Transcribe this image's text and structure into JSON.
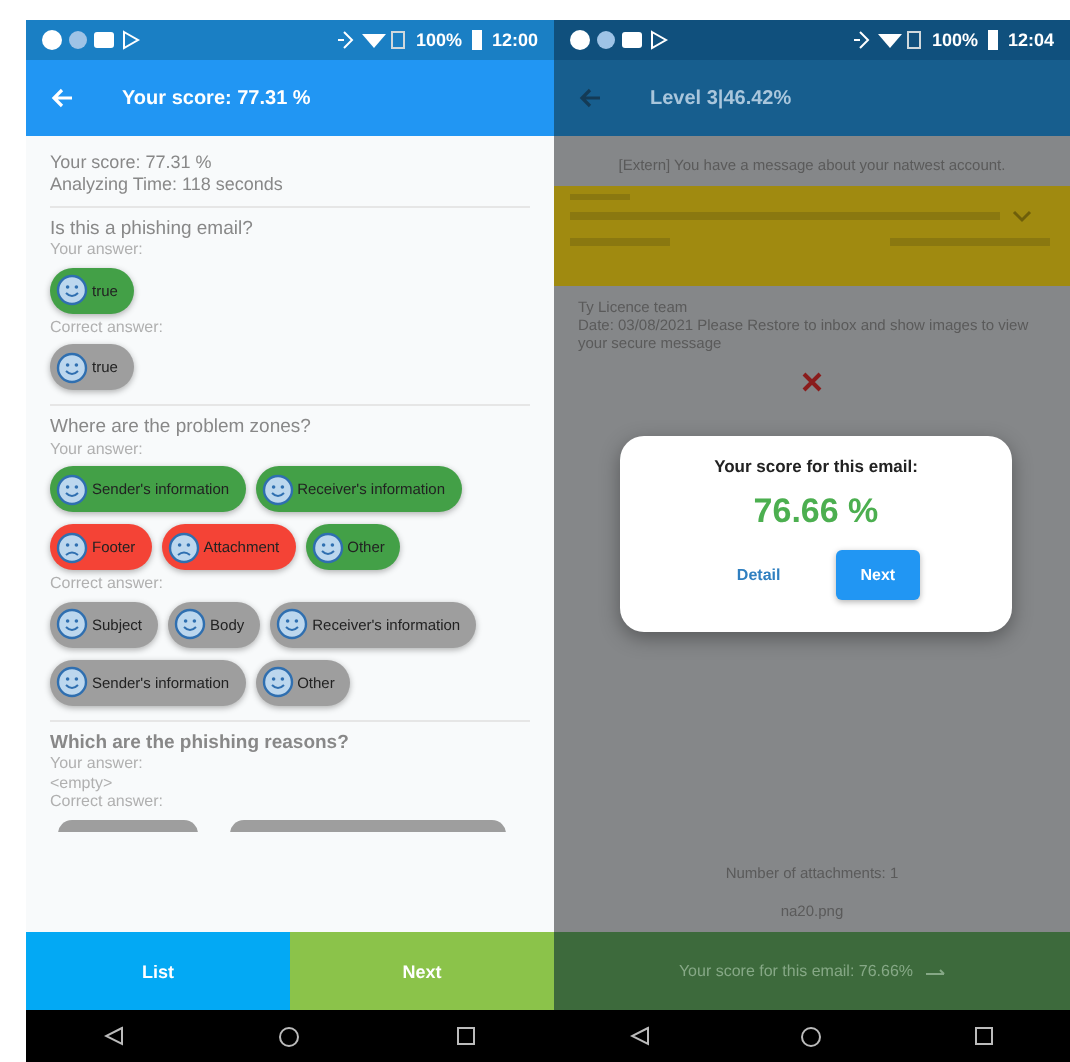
{
  "left_screen": {
    "status_bar": {
      "battery": "100%",
      "time": "12:00"
    },
    "app_bar": {
      "title": "Your score: 77.31 %"
    },
    "summary": [
      "Your score: 77.31 %",
      "Analyzing Time: 118 seconds"
    ],
    "questions": [
      {
        "question": "Is this a phishing email?",
        "your_label": "Your answer:",
        "your_answers": [
          {
            "text": "true",
            "kind": "correct"
          }
        ],
        "correct_label": "Correct answer:",
        "correct_answers": [
          {
            "text": "true",
            "kind": "reference"
          }
        ]
      },
      {
        "question": "Where are the problem zones?",
        "your_label": "Your answer:",
        "your_answers": [
          {
            "text": "Sender's information",
            "kind": "correct"
          },
          {
            "text": "Receiver's information",
            "kind": "correct"
          },
          {
            "text": "Footer",
            "kind": "wrong"
          },
          {
            "text": "Attachment",
            "kind": "wrong"
          },
          {
            "text": "Other",
            "kind": "correct"
          }
        ],
        "correct_label": "Correct answer:",
        "correct_answers": [
          {
            "text": "Subject",
            "kind": "reference"
          },
          {
            "text": "Body",
            "kind": "reference"
          },
          {
            "text": "Receiver's information",
            "kind": "reference"
          },
          {
            "text": "Sender's information",
            "kind": "reference"
          },
          {
            "text": "Other",
            "kind": "reference"
          }
        ]
      },
      {
        "question": "Which are the phishing reasons?",
        "your_label": "Your answer:",
        "your_empty": "<empty>",
        "correct_label": "Correct answer:"
      }
    ],
    "buttons": [
      {
        "label": "List",
        "kind": "list"
      },
      {
        "label": "Next",
        "kind": "next"
      }
    ]
  },
  "right_screen": {
    "status_bar": {
      "battery": "100%",
      "time": "12:04"
    },
    "app_bar": {
      "title": "Level 3|46.42%"
    },
    "subject": "[Extern] You have a message about your natwest account.",
    "body": [
      "Ty Licence team",
      "Date: 03/08/2021 Please Restore to inbox and show images to view your secure message"
    ],
    "attachments": "Number of attachments: 1",
    "attachment_file": "na20.png",
    "bottom_bar": "Your score for this email: 76.66%",
    "dialog": {
      "title": "Your score for this email:",
      "score": "76.66 %",
      "buttons": [
        {
          "label": "Detail",
          "kind": "text"
        },
        {
          "label": "Next",
          "kind": "filled"
        }
      ]
    }
  }
}
